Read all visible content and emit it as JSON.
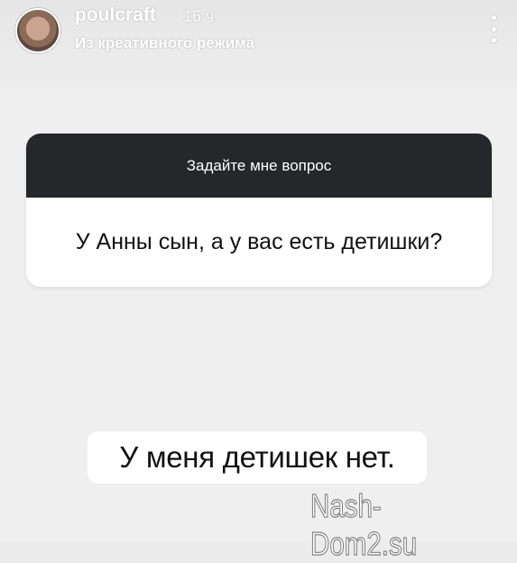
{
  "header": {
    "username": "poulcraft",
    "time": "16 ч.",
    "subtitle": "Из креативного режима"
  },
  "question_sticker": {
    "title": "Задайте мне вопрос",
    "question": "У Анны сын, а у вас есть детишки?"
  },
  "answer": {
    "text": "У меня детишек нет."
  },
  "watermark": {
    "text": "Nash-Dom2.su"
  },
  "icons": {
    "more": "more-vertical-icon",
    "avatar": "profile-avatar"
  }
}
